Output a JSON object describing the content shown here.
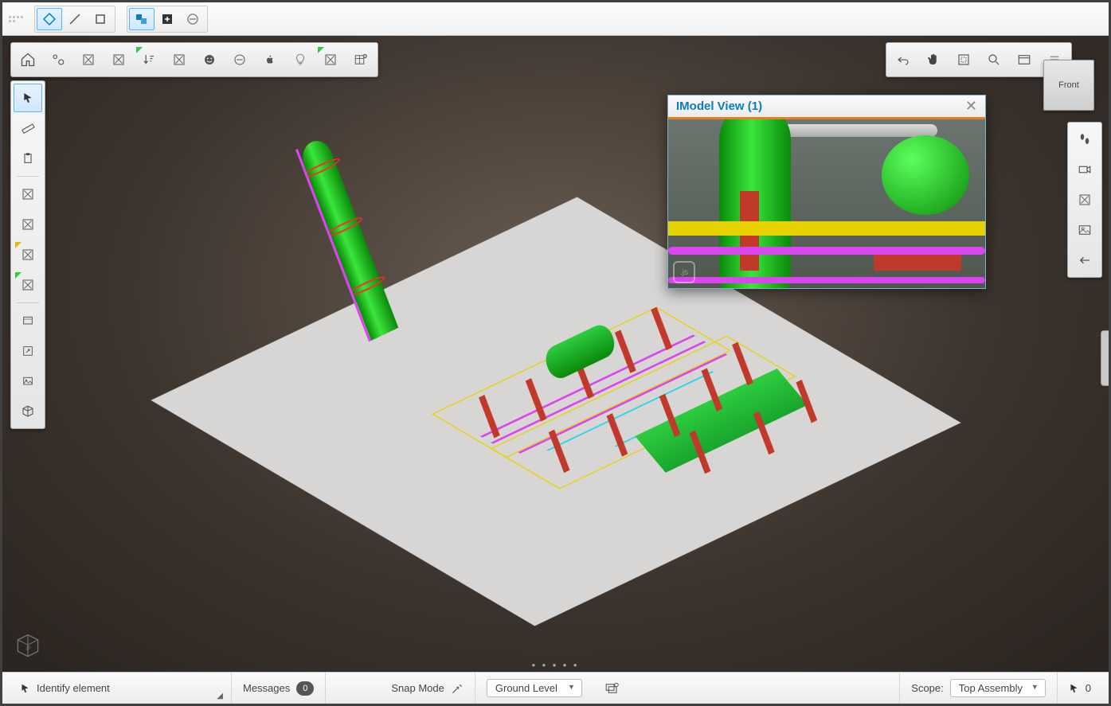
{
  "top_toolbar": {
    "items": [
      "drag-handle",
      "snap-point",
      "snap-line",
      "snap-rect",
      "selection-group",
      "add-box",
      "remove-circle"
    ]
  },
  "horiz_toolbar": {
    "items": [
      "home",
      "settings",
      "box-x-1",
      "box-x-2",
      "sort-down",
      "box-x-3",
      "smiley",
      "minus-circle",
      "apple",
      "bulb",
      "box-x-4",
      "grid-add"
    ]
  },
  "left_toolbar": {
    "items": [
      "cursor",
      "ruler",
      "clipboard",
      "box-x-a",
      "box-x-b",
      "box-x-c",
      "box-x-d",
      "window",
      "expand",
      "image",
      "cube"
    ]
  },
  "right_top_toolbar": {
    "items": [
      "undo",
      "pan-hand",
      "fit-view",
      "zoom-search",
      "window-view",
      "list-view"
    ]
  },
  "right_edge_toolbar": {
    "items": [
      "footprints",
      "camera",
      "box-x",
      "photo",
      "arrow-left"
    ]
  },
  "view_cube": {
    "label": "Front"
  },
  "overlay": {
    "title": "IModel View (1)"
  },
  "statusbar": {
    "identify_label": "Identify element",
    "messages_label": "Messages",
    "messages_count": "0",
    "snap_label": "Snap Mode",
    "level_dropdown": "Ground Level",
    "scope_label": "Scope:",
    "scope_dropdown": "Top Assembly",
    "selection_count": "0"
  },
  "colors": {
    "accent": "#0b7dbf",
    "highlight_border": "#e67e22",
    "plant_green": "#2ecc40",
    "pipe_magenta": "#d946ef",
    "support_red": "#c0392b",
    "frame_yellow": "#e6d200"
  }
}
